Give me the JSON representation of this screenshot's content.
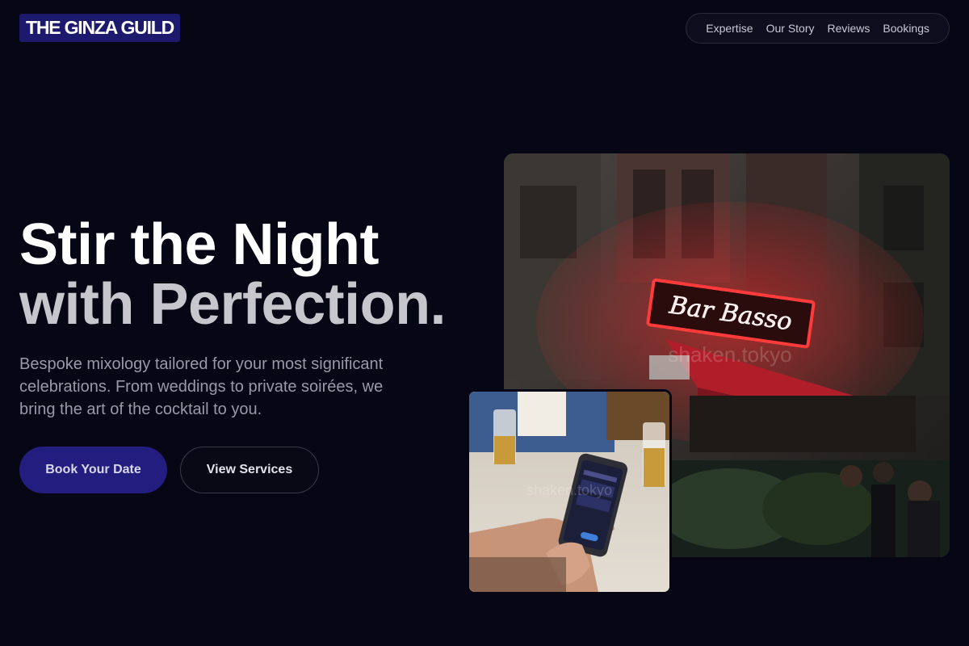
{
  "brand": {
    "name": "THE GINZA GUILD"
  },
  "nav": {
    "items": [
      "Expertise",
      "Our Story",
      "Reviews",
      "Bookings"
    ]
  },
  "hero": {
    "headline_line1": "Stir the Night",
    "headline_line2": "with Perfection.",
    "subtext": "Bespoke mixology tailored for your most significant celebrations. From weddings to private soirées, we bring the art of the cocktail to you.",
    "primary_cta": "Book Your Date",
    "secondary_cta": "View Services"
  },
  "images": {
    "main_photo_sign": "Bar Basso",
    "watermark": "shaken.tokyo"
  },
  "colors": {
    "background": "#070614",
    "logo_bg": "#1d1a6d",
    "primary_button": "#221d7e",
    "neon_red": "#ff3b3b"
  }
}
